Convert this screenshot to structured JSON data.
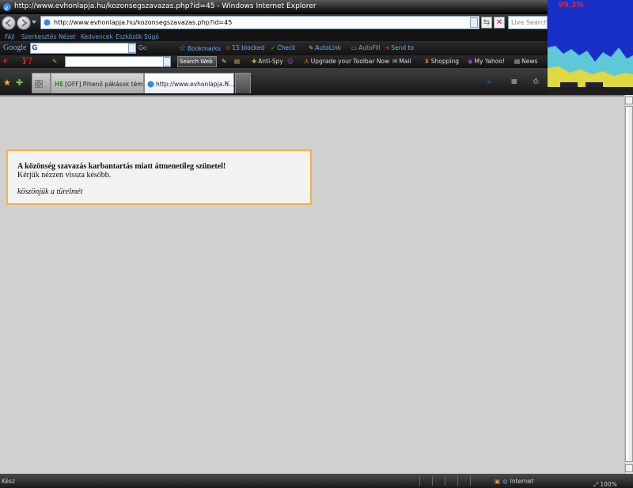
{
  "window": {
    "title": "http://www.evhonlapja.hu/kozonsegszavazas.php?id=45 - Windows Internet Explorer"
  },
  "address": {
    "url": "http://www.evhonlapja.hu/kozonsegszavazas.php?id=45",
    "search_placeholder": "Live Search"
  },
  "menu": [
    "Fájl",
    "Szerkesztés",
    "Nézet",
    "Kedvencek",
    "Eszközök",
    "Súgó"
  ],
  "google_toolbar": {
    "logo": "Google",
    "go": "Go",
    "bookmarks": "Bookmarks",
    "blocked": "15 blocked",
    "check": "Check",
    "autolink": "AutoLink",
    "autofill": "AutoFill",
    "send_to": "Send to"
  },
  "yahoo_toolbar": {
    "logo": "Y!",
    "search_web": "Search Web",
    "anti_spy": "Anti-Spy",
    "upgrade": "Upgrade your Toolbar Now",
    "mail": "Mail",
    "shopping": "Shopping",
    "my_yahoo": "My Yahoo!",
    "news": "News"
  },
  "tabs": [
    {
      "badge": "HE",
      "label": "[OFF] Pihenő pákások témáj..."
    },
    {
      "label": "http://www.evhonlapja.h..."
    }
  ],
  "notice": {
    "headline": "A közönség szavazás karbantartás miatt átmenetileg szünetel!",
    "body": "Kérjük nézzen vissza később.",
    "thanks": "köszönjük a türelmét"
  },
  "status": {
    "text": "Kész",
    "zone": "Internet",
    "zoom": "100%"
  },
  "gadget": {
    "percent": "99,3%"
  },
  "colors": {
    "notice_border": "#f6b04a",
    "content_bg": "#d0d0d0"
  }
}
